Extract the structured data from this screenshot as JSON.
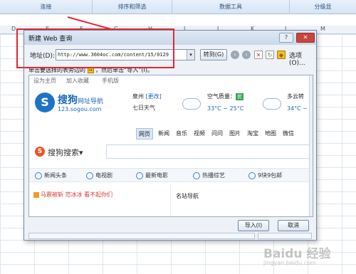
{
  "ribbon": {
    "groups": [
      "连接",
      "排序和筛选",
      "数据工具",
      "分级显"
    ]
  },
  "columns": [
    "D",
    "E",
    "F",
    "G",
    "H",
    "I",
    "J",
    "K",
    "L",
    "M"
  ],
  "dialog": {
    "title": "新建 Web 查询",
    "help_btn": "?",
    "close_btn": "✕",
    "address_label": "地址(D):",
    "address_value": "http://www.3604oc.com/content/15/0129",
    "dropdown_glyph": "▾",
    "go_btn": "转到(G)",
    "options_label": "选项(O)...",
    "hint": "单击要选择的表旁边的",
    "hint_tail": "，然后单击“导入”(I)。",
    "hint_icon_glyph": "→",
    "import_btn": "导入(I)",
    "cancel_btn": "取消"
  },
  "web": {
    "top_links": [
      "设为主页",
      "加入收藏",
      "手机版"
    ],
    "logo_glyph": "S",
    "brand": "搜狗",
    "brand_suffix": "网址导航",
    "brand_sub": "123.sogou.com",
    "city": "泉州",
    "city_change": "[更改]",
    "forecast": "七日天气",
    "air_label": "空气质量：",
    "air_badge": "优",
    "temp1": "33°C ~ 25°C",
    "w2_label": "多云转",
    "temp2": "34°C ~",
    "nav_tabs": [
      "网页",
      "新闻",
      "音乐",
      "视频",
      "问问",
      "图片",
      "淘宝",
      "地图",
      "微信"
    ],
    "search_logo": "S",
    "search_name": "搜狗搜索",
    "search_caret": "▾",
    "categories": [
      "新闻头条",
      "电视剧",
      "最新电影",
      "热播综艺",
      "9块9包邮"
    ],
    "news_item": "马震被斩 范冰冰 看不起你们",
    "sites_title": "名站导航"
  },
  "watermark": {
    "text": "Baidu 经验",
    "url": "jingyan.baidu.com"
  },
  "colors": {
    "highlight_red": "#e8232f",
    "sogou_blue": "#1a66b8"
  }
}
